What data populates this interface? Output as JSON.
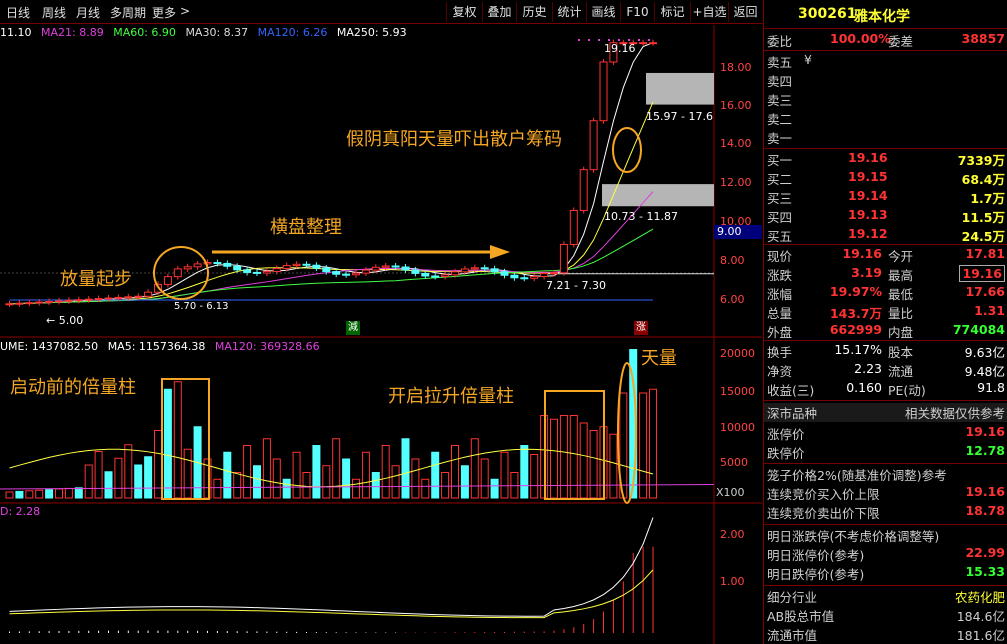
{
  "toolbar": {
    "periods": [
      "日线",
      "周线",
      "月线",
      "多周期",
      "更多"
    ],
    "more_arrow": ">",
    "buttons": [
      "复权",
      "叠加",
      "历史",
      "统计",
      "画线",
      "F10",
      "标记",
      "+自选",
      "返回"
    ]
  },
  "kline_legend": {
    "ma5": "11.10",
    "ma21": "MA21: 8.89",
    "ma60": "MA60: 6.90",
    "ma30": "MA30: 8.37",
    "ma120": "MA120: 6.26",
    "ma250": "MA250: 5.93"
  },
  "volume_legend": {
    "vol": "UME: 1437082.50",
    "ma5": "MA5: 1157364.38",
    "ma120": "MA120: 369328.66"
  },
  "macd_legend": {
    "value": "D: 2.28"
  },
  "price_axis": [
    "18.00",
    "16.00",
    "14.00",
    "12.00",
    "10.00",
    "8.00",
    "6.00"
  ],
  "price_current": "9.00",
  "volume_axis": [
    "20000",
    "15000",
    "10000",
    "5000"
  ],
  "volume_unit": "X100",
  "macd_axis": [
    "2.00",
    "1.00"
  ],
  "price_labels": {
    "high": "19.16",
    "zone_upper": "15.97 - 17.6",
    "zone_mid": "10.73 - 11.87",
    "zone_low": "7.21 - 7.30",
    "low_left": "5.00",
    "low_mid": "5.70 - 6.13"
  },
  "markers": {
    "reduce": "減",
    "rise": "涨"
  },
  "annotations": {
    "start": "放量起步",
    "consolidate": "横盘整理",
    "fake_yin": "假阴真阳天量吓出散户筹码",
    "before_start": "启动前的倍量柱",
    "lift": "开启拉升倍量柱",
    "huge": "天量"
  },
  "colors": {
    "up": "#ff3333",
    "down": "#54ffff",
    "ma_yellow": "#ffff40",
    "ma_white": "#ffffff",
    "ma_purple": "#e040e0",
    "annotation": "#f5a623"
  },
  "stock": {
    "code": "300261",
    "name": "雅本化学"
  },
  "quote": {
    "weibi_label": "委比",
    "weibi": "100.00%",
    "weicha_label": "委差",
    "weicha": "38857",
    "asks": [
      {
        "label": "卖五",
        "price": "¥",
        "vol": ""
      },
      {
        "label": "卖四",
        "price": "",
        "vol": ""
      },
      {
        "label": "卖三",
        "price": "",
        "vol": ""
      },
      {
        "label": "卖二",
        "price": "",
        "vol": ""
      },
      {
        "label": "卖一",
        "price": "",
        "vol": ""
      }
    ],
    "bids": [
      {
        "label": "买一",
        "price": "19.16",
        "vol": "7339万"
      },
      {
        "label": "买二",
        "price": "19.15",
        "vol": "68.4万"
      },
      {
        "label": "买三",
        "price": "19.14",
        "vol": "1.7万"
      },
      {
        "label": "买四",
        "price": "19.13",
        "vol": "11.5万"
      },
      {
        "label": "买五",
        "price": "19.12",
        "vol": "24.5万"
      }
    ],
    "stats": [
      {
        "l1": "现价",
        "v1": "19.16",
        "l2": "今开",
        "v2": "17.81",
        "c2": "red"
      },
      {
        "l1": "涨跌",
        "v1": "3.19",
        "l2": "最高",
        "v2": "19.16",
        "c2": "red"
      },
      {
        "l1": "涨幅",
        "v1": "19.97%",
        "l2": "最低",
        "v2": "17.66",
        "c2": "red"
      },
      {
        "l1": "总量",
        "v1": "143.7万",
        "l2": "量比",
        "v2": "1.31",
        "c2": "red"
      },
      {
        "l1": "外盘",
        "v1": "662999",
        "l2": "内盘",
        "v2": "774084",
        "c2": "green"
      }
    ],
    "stats2": [
      {
        "l1": "换手",
        "v1": "15.17%",
        "l2": "股本",
        "v2": "9.63亿"
      },
      {
        "l1": "净资",
        "v1": "2.23",
        "l2": "流通",
        "v2": "9.48亿"
      },
      {
        "l1": "收益(三)",
        "v1": "0.160",
        "l2": "PE(动)",
        "v2": "91.8"
      }
    ],
    "market_type": "深市品种",
    "market_ref": "相关数据仅供参考",
    "limit_up_label": "涨停价",
    "limit_up": "19.16",
    "limit_down_label": "跌停价",
    "limit_down": "12.78",
    "cage_label": "笼子价格2%(随基准价调整)参考",
    "auction_buy_label": "连续竞价买入价上限",
    "auction_buy": "19.16",
    "auction_sell_label": "连续竞价卖出价下限",
    "auction_sell": "18.78",
    "next_label": "明日涨跌停(不考虑价格调整等)",
    "next_up_label": "明日涨停价(参考)",
    "next_up": "22.99",
    "next_down_label": "明日跌停价(参考)",
    "next_down": "15.33",
    "industry_label": "细分行业",
    "industry": "农药化肥",
    "ab_cap_label": "AB股总市值",
    "ab_cap": "184.6亿",
    "float_cap_label": "流通市值",
    "float_cap": "181.6亿"
  }
}
